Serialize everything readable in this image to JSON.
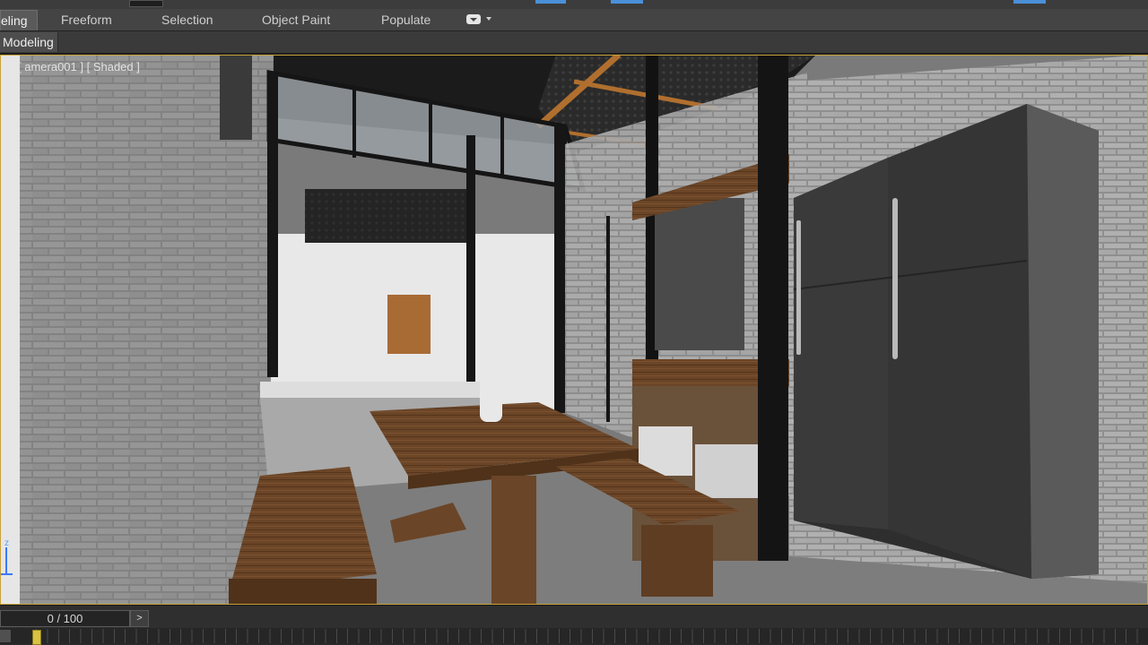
{
  "ribbon": {
    "tabs": [
      {
        "label": "eling",
        "active": true
      },
      {
        "label": "Freeform",
        "active": false
      },
      {
        "label": "Selection",
        "active": false
      },
      {
        "label": "Object Paint",
        "active": false
      },
      {
        "label": "Populate",
        "active": false
      }
    ],
    "extra_menu_icon": "dropdown-menu-icon",
    "panel_label": "Modeling"
  },
  "viewport": {
    "label": "[ amera001 ] [ Shaded ]",
    "axis_label": "z",
    "scene_description_icon": "rendered-kitchen-scene"
  },
  "time_slider": {
    "frame_display": "0 / 100",
    "next_button": ">",
    "current_frame_fraction": 0.0
  },
  "colors": {
    "accent_frame": "#c8a23a",
    "thumb": "#d8c243",
    "toolbar_chip": "#4a90d9"
  }
}
